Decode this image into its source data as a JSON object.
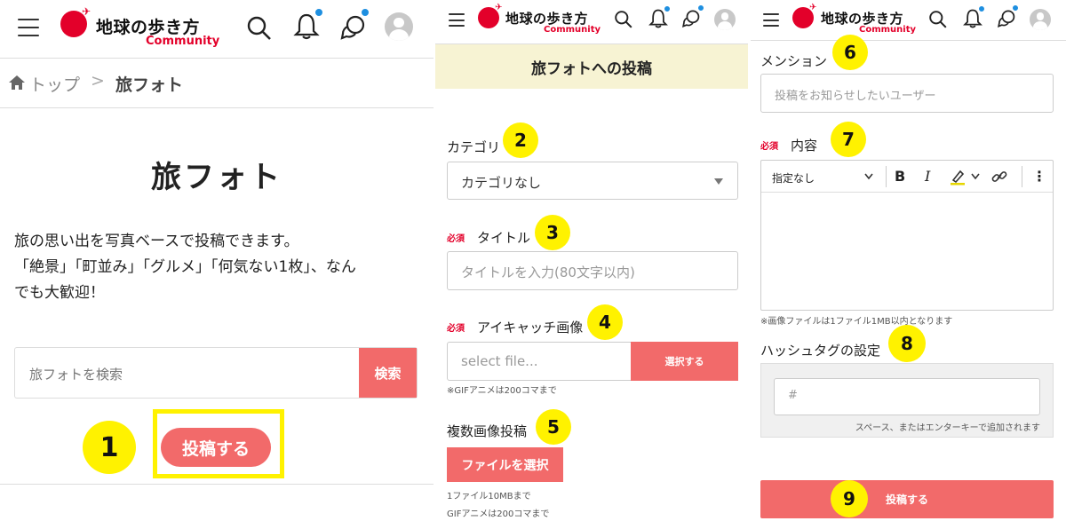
{
  "header": {
    "logo_jp": "地球の歩き方",
    "logo_en": "Community"
  },
  "panel1": {
    "breadcrumb": {
      "home": "トップ",
      "separator": ">",
      "current": "旅フォト"
    },
    "title": "旅フォト",
    "description": [
      "旅の思い出を写真ベースで投稿できます。",
      "「絶景」「町並み」「グルメ」「何気ない1枚」、なん",
      "でも大歓迎！"
    ],
    "search": {
      "placeholder": "旅フォトを検索",
      "button": "検索"
    },
    "post_button": "投稿する"
  },
  "panel2": {
    "page_title": "旅フォトへの投稿",
    "required_mark": "必須",
    "category": {
      "label": "カテゴリ",
      "value": "カテゴリなし"
    },
    "title_field": {
      "label": "タイトル",
      "placeholder": "タイトルを入力(80文字以内)"
    },
    "eyecatch": {
      "label": "アイキャッチ画像",
      "placeholder": "select file...",
      "button": "選択する",
      "note": "※GIFアニメは200コマまで"
    },
    "multi_image": {
      "label": "複数画像投稿",
      "button": "ファイルを選択",
      "note1": "1ファイル10MBまで",
      "note2": "GIFアニメは200コマまで"
    }
  },
  "panel3": {
    "mention": {
      "label": "メンション",
      "placeholder": "投稿をお知らせしたいユーザー"
    },
    "content": {
      "label": "内容",
      "format": "指定なし",
      "bold": "B",
      "italic": "I",
      "more": "⋮",
      "note": "※画像ファイルは1ファイル1MB以内となります"
    },
    "hashtag": {
      "label": "ハッシュタグの設定",
      "placeholder": "#",
      "note": "スペース、またはエンターキーで追加されます"
    },
    "submit": "投稿する"
  },
  "badges": [
    "1",
    "2",
    "3",
    "4",
    "5",
    "6",
    "7",
    "8",
    "9"
  ],
  "colors": {
    "accent": "#f26a6a",
    "highlight": "#fff200",
    "brand_red": "#e3002a",
    "notification": "#1e8fe0",
    "title_band": "#f7f3d3"
  }
}
